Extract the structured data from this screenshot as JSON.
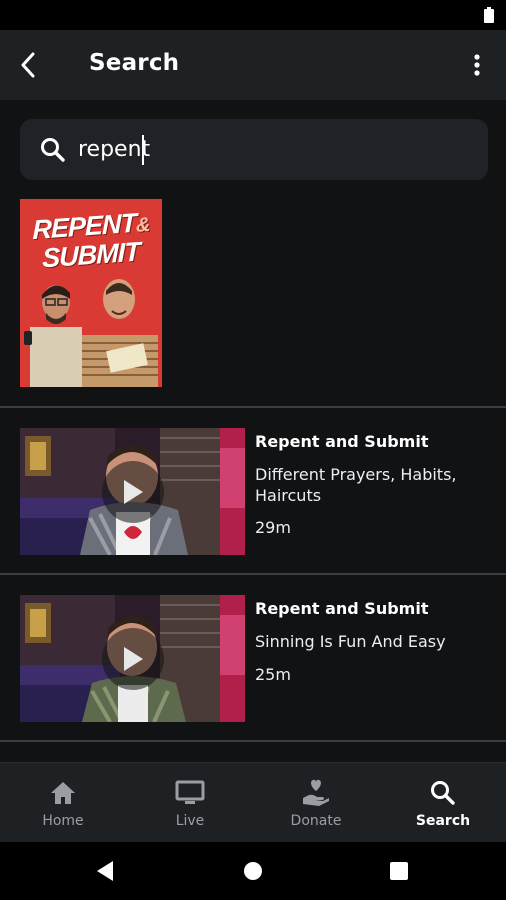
{
  "app": {
    "title": "Search"
  },
  "search": {
    "value": "repent",
    "placeholder": "Search"
  },
  "show_result": {
    "poster_line1": "REPENT",
    "poster_amp": "&",
    "poster_line2": "SUBMIT"
  },
  "episodes": [
    {
      "show": "Repent and Submit",
      "title": "Different Prayers, Habits, Haircuts",
      "duration": "29m"
    },
    {
      "show": "Repent and Submit",
      "title": "Sinning Is Fun And Easy",
      "duration": "25m"
    }
  ],
  "bottom_nav": [
    {
      "label": "Home",
      "icon": "home-icon",
      "active": false
    },
    {
      "label": "Live",
      "icon": "monitor-icon",
      "active": false
    },
    {
      "label": "Donate",
      "icon": "donate-icon",
      "active": false
    },
    {
      "label": "Search",
      "icon": "search-icon",
      "active": true
    }
  ],
  "colors": {
    "background": "#111214",
    "app_bar": "#1e2124",
    "poster_red": "#d93a33",
    "inactive_label": "#9a9da1"
  }
}
